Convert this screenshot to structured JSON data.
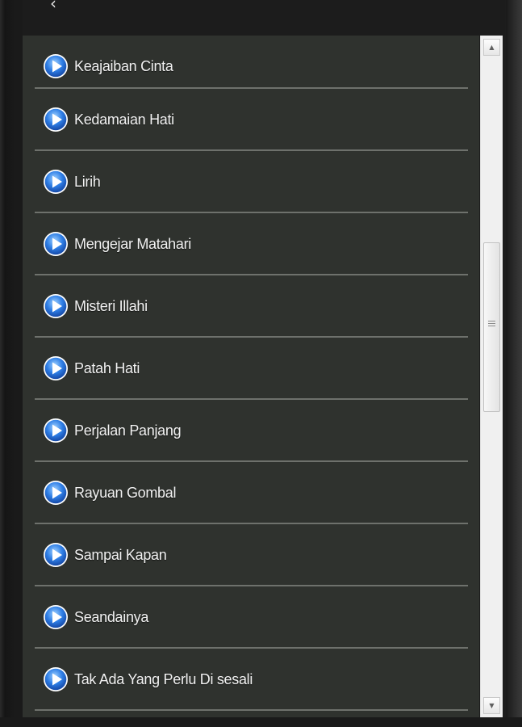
{
  "header": {
    "back_glyph": "‹"
  },
  "list": {
    "items": [
      {
        "label": "Keajaiban Cinta",
        "icon": "play-icon"
      },
      {
        "label": "Kedamaian Hati",
        "icon": "play-icon"
      },
      {
        "label": "Lirih",
        "icon": "play-icon"
      },
      {
        "label": "Mengejar Matahari",
        "icon": "play-icon"
      },
      {
        "label": "Misteri Illahi",
        "icon": "play-icon"
      },
      {
        "label": "Patah Hati",
        "icon": "play-icon"
      },
      {
        "label": "Perjalan Panjang",
        "icon": "play-icon"
      },
      {
        "label": "Rayuan Gombal",
        "icon": "play-icon"
      },
      {
        "label": "Sampai Kapan",
        "icon": "play-icon"
      },
      {
        "label": "Seandainya",
        "icon": "play-icon"
      },
      {
        "label": "Tak Ada Yang Perlu Di sesali",
        "icon": "play-icon"
      }
    ]
  },
  "scrollbar": {
    "up_glyph": "▲",
    "down_glyph": "▼"
  },
  "colors": {
    "list_background": "#2f322e",
    "divider": "#6e716c",
    "text": "#f2f2f2",
    "play_icon_blue": "#2f7fe6"
  }
}
